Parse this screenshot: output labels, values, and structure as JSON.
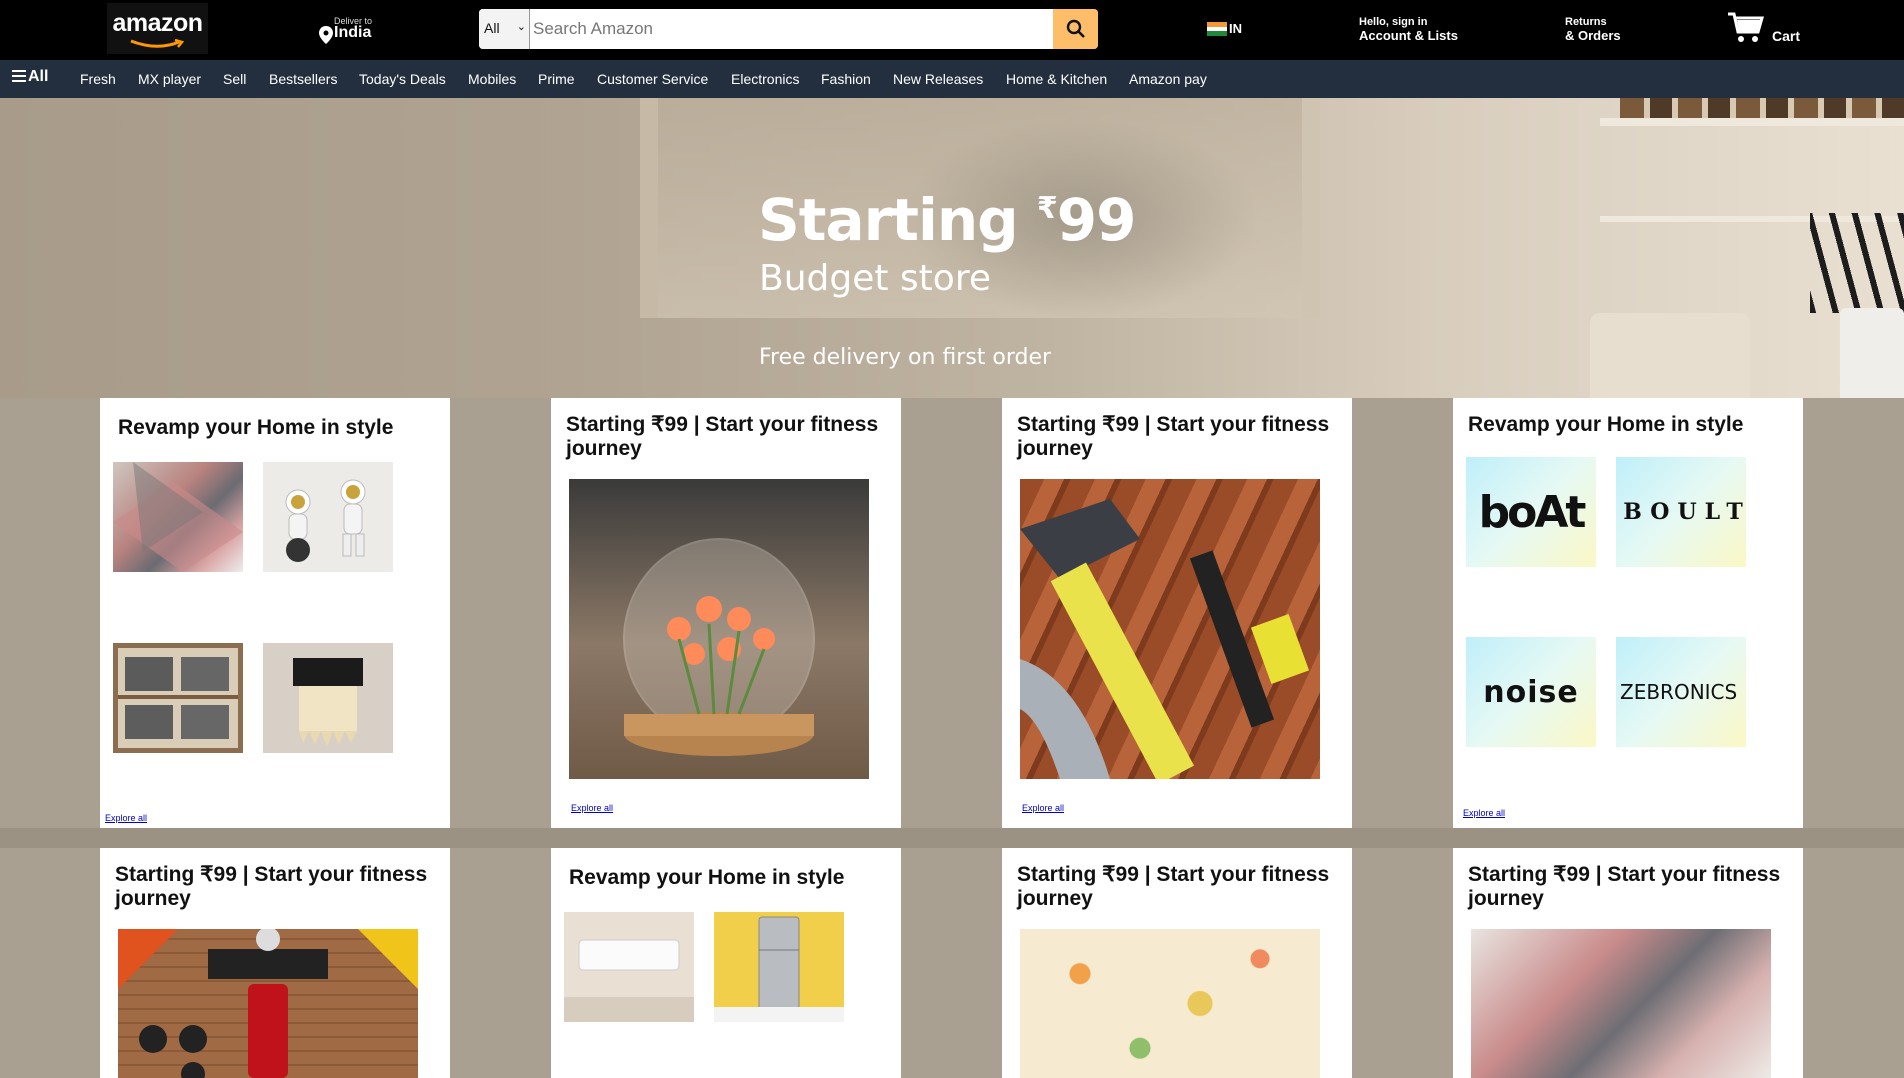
{
  "header": {
    "logo_text": "amazon",
    "deliver_small": "Deliver to",
    "deliver_location": "India",
    "search": {
      "category": "All",
      "placeholder": "Search Amazon"
    },
    "lang": "IN",
    "account_small": "Hello, sign in",
    "account_big": "Account & Lists",
    "returns_small": "Returns",
    "returns_big": "& Orders",
    "cart_label": "Cart"
  },
  "nav": {
    "all_label": "All",
    "items": [
      "Fresh",
      "MX player",
      "Sell",
      "Bestsellers",
      "Today's Deals",
      "Mobiles",
      "Prime",
      "Customer Service",
      "Electronics",
      "Fashion",
      "New Releases",
      "Home & Kitchen",
      "Amazon pay"
    ]
  },
  "hero": {
    "title": "Starting",
    "price_symbol": "₹",
    "price": "99",
    "subtitle": "Budget store",
    "note": "Free delivery on first order"
  },
  "cards": [
    {
      "title": "Revamp your Home in style",
      "explore": "Explore all",
      "tiles": [
        "rug-image",
        "astronaut-figurines-image",
        "storage-boxes-image",
        "wall-lamp-image"
      ]
    },
    {
      "title": "Starting ₹99 | Start your fitness journey",
      "explore": "Explore all",
      "image": "tulip-glass-lamp-image"
    },
    {
      "title": "Starting ₹99 | Start your fitness journey",
      "explore": "Explore all",
      "image": "hand-tools-image"
    },
    {
      "title": "Revamp your Home in style",
      "explore": "Explore all",
      "brands": [
        "boAt",
        "BOULT",
        "noise",
        "ZEBRONICS"
      ]
    },
    {
      "title": "Starting ₹99 | Start your fitness journey",
      "image": "home-gym-image"
    },
    {
      "title": "Revamp your Home in style",
      "tiles": [
        "air-conditioner-image",
        "refrigerator-image"
      ]
    },
    {
      "title": "Starting ₹99 | Start your fitness journey",
      "image": "floral-fabric-image"
    },
    {
      "title": "Starting ₹99 | Start your fitness journey",
      "image": "geometric-rug-image"
    }
  ]
}
